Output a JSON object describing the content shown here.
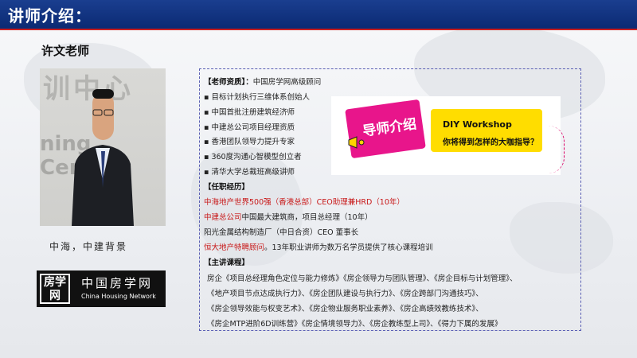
{
  "header": {
    "title": "讲师介绍："
  },
  "teacher": {
    "name": "许文老师",
    "caption": "中海，中建背景"
  },
  "logo": {
    "cn": "中国房学网",
    "en": "China Housing Network",
    "mark": "房学网"
  },
  "diy": {
    "badge": "导师介绍",
    "title": "DIY Workshop",
    "subtitle": "你将得到怎样的大咖指导？"
  },
  "qualifications": {
    "heading": "【老师资质】：",
    "heading_value": "中国房学网高级顾问",
    "items": [
      "目标计划执行三维体系创始人",
      "中国首批注册建筑经济师",
      "中建总公司项目经理资质",
      "香港团队领导力提升专家",
      "360度沟通心智模型创立者",
      "清华大学总裁班高级讲师"
    ]
  },
  "experience": {
    "heading": "【任职经历】",
    "items": [
      {
        "red": "中海地产世界500强（香港总部）CEO助理兼HRD（10年）",
        "rest": ""
      },
      {
        "red": "中建总公司",
        "rest": "中国最大建筑商，项目总经理（10年）"
      },
      {
        "red": "",
        "rest": "阳光金属结构制造厂（中日合资）CEO 董事长"
      },
      {
        "red": "恒大地产特聘顾问",
        "rest": "。13年职业讲师为数万名学员提供了核心课程培训"
      }
    ]
  },
  "courses": {
    "heading": "【主讲课程】",
    "lines": [
      "房企《项目总经理角色定位与能力修炼》《房企领导力与团队管理》、《房企目标与计划管理》、",
      "《地产项目节点达成执行力》、《房企团队建设与执行力》、《房企跨部门沟通技巧》、",
      "《房企领导效能与权变艺术》、《房企物业服务职业素养》、《房企高绩效教练技术》、",
      "《房企MTP进阶6D训练营》《房企情境领导力》、《房企教练型上司》、《得力下属的发展》"
    ]
  },
  "colors": {
    "header": "#0b2a73",
    "accent_red": "#c81818",
    "badge_pink": "#e8158b",
    "yellow": "#ffdd00"
  }
}
